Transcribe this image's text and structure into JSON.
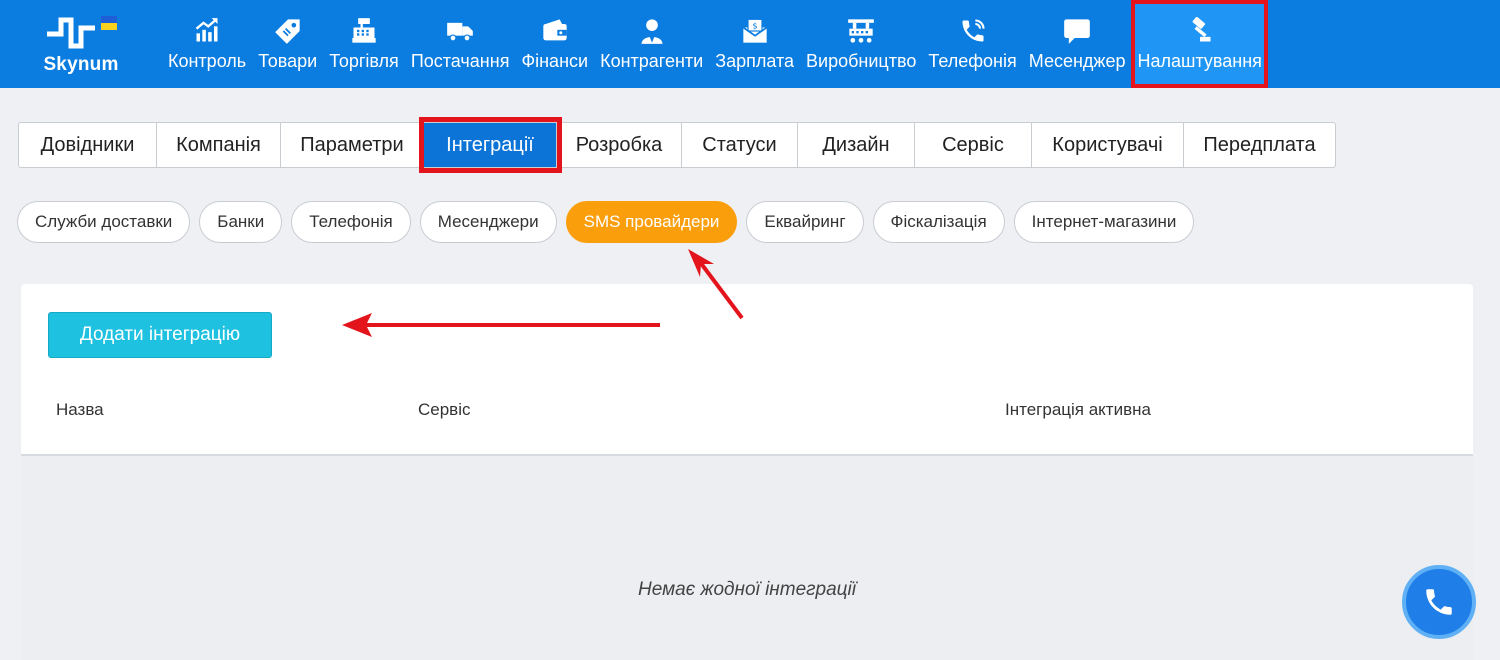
{
  "brand": {
    "name": "Skynum"
  },
  "nav": [
    {
      "label": "Контроль",
      "icon": "chart-up-icon"
    },
    {
      "label": "Товари",
      "icon": "tag-icon"
    },
    {
      "label": "Торгівля",
      "icon": "cash-register-icon"
    },
    {
      "label": "Постачання",
      "icon": "truck-icon"
    },
    {
      "label": "Фінанси",
      "icon": "wallet-icon"
    },
    {
      "label": "Контрагенти",
      "icon": "person-tie-icon"
    },
    {
      "label": "Зарплата",
      "icon": "envelope-money-icon"
    },
    {
      "label": "Виробництво",
      "icon": "factory-icon"
    },
    {
      "label": "Телефонія",
      "icon": "phone-ring-icon"
    },
    {
      "label": "Месенджер",
      "icon": "chat-bubble-icon"
    },
    {
      "label": "Налаштування",
      "icon": "hammer-icon"
    }
  ],
  "tabs": [
    "Довідники",
    "Компанія",
    "Параметри",
    "Інтеграції",
    "Розробка",
    "Статуси",
    "Дизайн",
    "Сервіс",
    "Користувачі",
    "Передплата"
  ],
  "active_tab": "Інтеграції",
  "pills": [
    "Служби доставки",
    "Банки",
    "Телефонія",
    "Месенджери",
    "SMS провайдери",
    "Еквайринг",
    "Фіскалізація",
    "Інтернет-магазини"
  ],
  "active_pill": "SMS провайдери",
  "main": {
    "add_button": "Додати інтеграцію",
    "columns": [
      "Назва",
      "Сервіс",
      "Інтеграція активна"
    ],
    "empty_text": "Немає жодної інтеграції"
  },
  "colors": {
    "nav_bg": "#0b7de0",
    "active_tab": "#0b74d6",
    "active_pill": "#fb9e0c",
    "button": "#1fc1e0",
    "highlight": "#e3141b"
  }
}
